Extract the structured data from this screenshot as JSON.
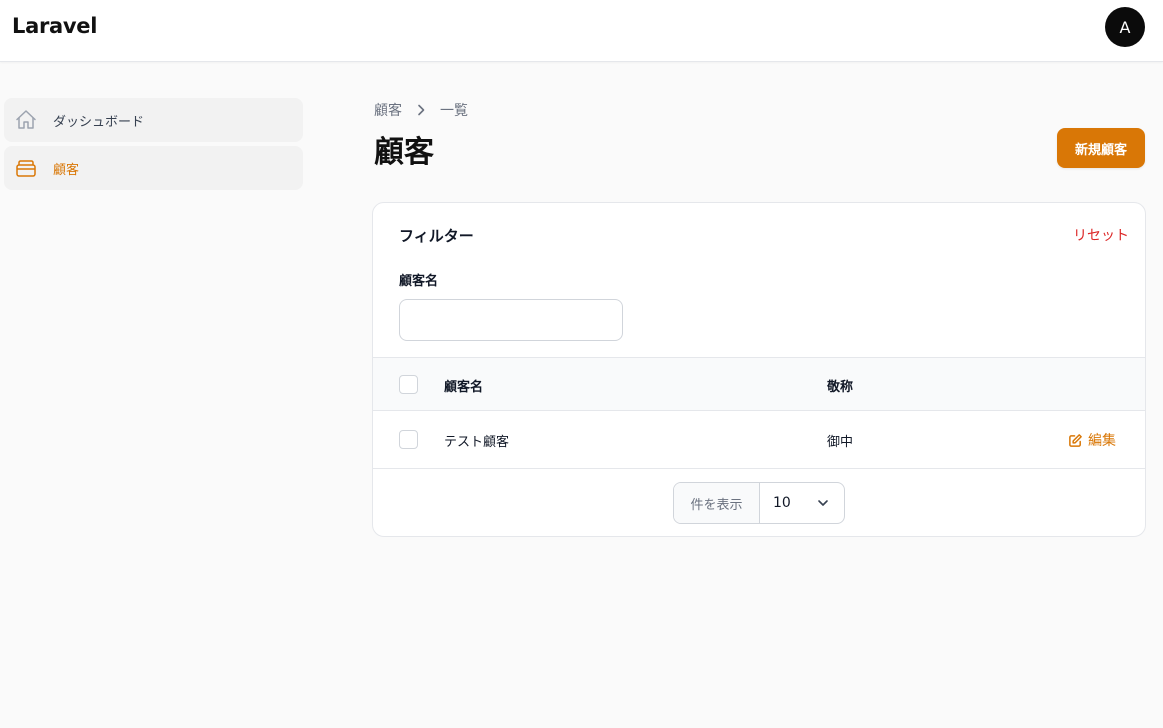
{
  "topbar": {
    "brand": "Laravel",
    "avatar_initial": "A"
  },
  "sidebar": {
    "items": [
      {
        "label": "ダッシュボード",
        "icon": "home-icon",
        "active": false
      },
      {
        "label": "顧客",
        "icon": "inbox-icon",
        "active": true
      }
    ]
  },
  "breadcrumb": {
    "root": "顧客",
    "current": "一覧"
  },
  "page": {
    "title": "顧客",
    "new_button": "新規顧客"
  },
  "filter": {
    "title": "フィルター",
    "reset": "リセット",
    "name_label": "顧客名",
    "name_value": ""
  },
  "table": {
    "columns": [
      "顧客名",
      "敬称"
    ],
    "rows": [
      {
        "name": "テスト顧客",
        "honorific": "御中",
        "action": "編集"
      }
    ]
  },
  "pagination": {
    "per_page_label": "件を表示",
    "per_page_value": "10"
  },
  "colors": {
    "accent": "#d97706",
    "danger": "#dc2626",
    "text": "#111827",
    "muted": "#6b7280",
    "avatar_bg": "#0b0b0b"
  }
}
